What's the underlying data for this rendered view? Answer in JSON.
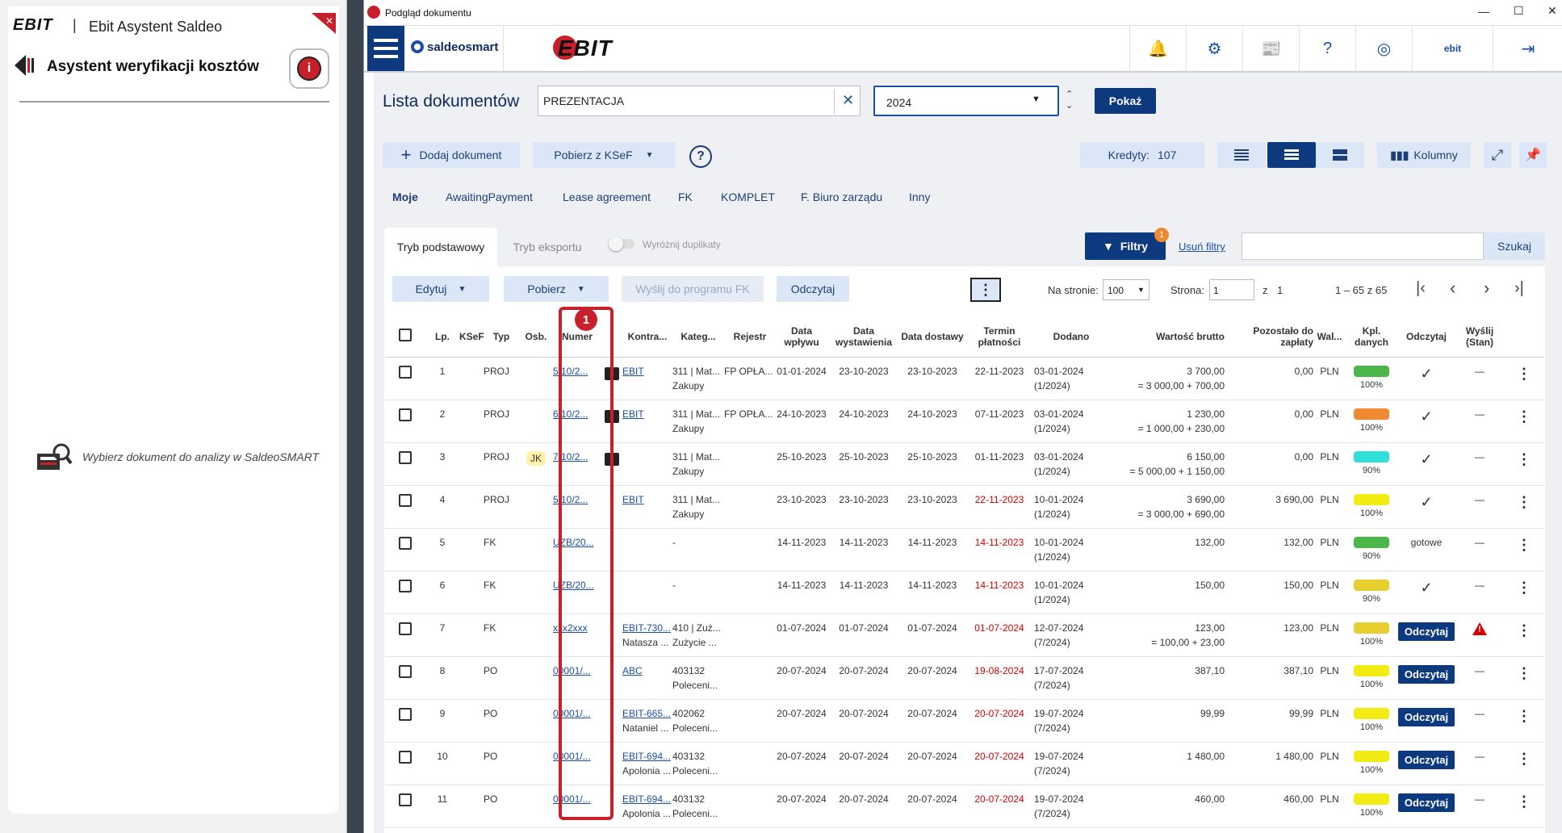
{
  "assistant": {
    "logo": "EBIT",
    "app_name": "Ebit Asystent Saldeo",
    "heading": "Asystent weryfikacji kosztów",
    "empty_message": "Wybierz dokument do analizy w SaldeoSMART"
  },
  "window": {
    "title": "Podgląd dokumentu",
    "controls": {
      "minimize": "—",
      "maximize": "☐",
      "close": "✕"
    }
  },
  "appbar": {
    "saldeo_logo": "saldeosmart",
    "ebit_logo": "EBIT",
    "user": "ebit"
  },
  "toolbar": {
    "page_title": "Lista dokumentów",
    "search_value": "PREZENTACJA",
    "year_value": "2024",
    "show_button": "Pokaż",
    "add_document": "Dodaj dokument",
    "fetch_ksef": "Pobierz z KSeF",
    "credits_label": "Kredyty:",
    "credits_value": "107",
    "columns_button": "Kolumny"
  },
  "categories": [
    "Moje",
    "AwaitingPayment",
    "Lease agreement",
    "FK",
    "KOMPLET",
    "F. Biuro zarządu",
    "Inny"
  ],
  "tabs": {
    "basic": "Tryb podstawowy",
    "export": "Tryb eksportu",
    "duplicates": "Wyróżnij duplikaty"
  },
  "filters": {
    "button": "Filtry",
    "badge": "1",
    "clear": "Usuń filtry",
    "search_button": "Szukaj",
    "search_value": ""
  },
  "actions": {
    "edit": "Edytuj",
    "download": "Pobierz",
    "send_fk": "Wyślij do programu FK",
    "read": "Odczytaj",
    "per_page_label": "Na stronie:",
    "per_page_value": "100",
    "page_label": "Strona:",
    "page_value": "1",
    "of_label": "z",
    "of_value": "1",
    "range": "1 – 65 z 65"
  },
  "annotation": {
    "marker": "1",
    "color": "#c8202a"
  },
  "colors": {
    "brand_dark": "#0d3a7e",
    "brand_light": "#dbe6f7",
    "green": "#4cb648",
    "orange": "#f08a32",
    "cyan": "#2ee0d8",
    "yellow": "#f2ec14",
    "gold": "#e8cf30",
    "red": "#d40000"
  },
  "table": {
    "headers": [
      "",
      "Lp.",
      "KSeF",
      "Typ",
      "Osb.",
      "Numer",
      "",
      "Kontra...",
      "Kateg...",
      "Rejestr",
      "Data wpływu",
      "Data wystawienia",
      "Data dostawy",
      "Termin płatności",
      "Dodano",
      "Wartość brutto",
      "Pozostało do zapłaty",
      "Wal...",
      "Kpl. danych",
      "Odczytaj",
      "Wyślij (Stan)",
      ""
    ],
    "rows": [
      {
        "lp": "1",
        "typ": "PROJ",
        "osb": "",
        "numer": "5/10/2...",
        "chat": true,
        "kontra": "EBIT",
        "kontra2": "",
        "kateg": "311 | Mat...",
        "kateg2": "Zakupy",
        "rejestr": "FP OPŁA...",
        "wplyw": "01-01-2024",
        "wyst": "23-10-2023",
        "dost": "23-10-2023",
        "termin": "22-11-2023",
        "termin_red": false,
        "dodano": "03-01-2024",
        "dodano2": "(1/2024)",
        "brutto": "3 700,00",
        "brutto2": "= 3 000,00 + 700,00",
        "pozostalo": "0,00",
        "wal": "PLN",
        "bar": "#4cb648",
        "pct": "100%",
        "odczytaj": "check",
        "wyslij": "—"
      },
      {
        "lp": "2",
        "typ": "PROJ",
        "osb": "",
        "numer": "6/10/2...",
        "chat": true,
        "kontra": "EBIT",
        "kontra2": "",
        "kateg": "311 | Mat...",
        "kateg2": "Zakupy",
        "rejestr": "FP OPŁA...",
        "wplyw": "24-10-2023",
        "wyst": "24-10-2023",
        "dost": "24-10-2023",
        "termin": "07-11-2023",
        "termin_red": false,
        "dodano": "03-01-2024",
        "dodano2": "(1/2024)",
        "brutto": "1 230,00",
        "brutto2": "= 1 000,00 + 230,00",
        "pozostalo": "0,00",
        "wal": "PLN",
        "bar": "#f08a32",
        "pct": "100%",
        "odczytaj": "check",
        "wyslij": "—"
      },
      {
        "lp": "3",
        "typ": "PROJ",
        "osb": "JK",
        "numer": "7/10/2...",
        "chat": true,
        "kontra": "",
        "kontra2": "",
        "kateg": "311 | Mat...",
        "kateg2": "Zakupy",
        "rejestr": "",
        "wplyw": "25-10-2023",
        "wyst": "25-10-2023",
        "dost": "25-10-2023",
        "termin": "01-11-2023",
        "termin_red": false,
        "dodano": "03-01-2024",
        "dodano2": "(1/2024)",
        "brutto": "6 150,00",
        "brutto2": "= 5 000,00 + 1 150,00",
        "pozostalo": "0,00",
        "wal": "PLN",
        "bar": "#2ee0d8",
        "pct": "90%",
        "odczytaj": "check",
        "wyslij": "—"
      },
      {
        "lp": "4",
        "typ": "PROJ",
        "osb": "",
        "numer": "5/10/2...",
        "chat": false,
        "kontra": "EBIT",
        "kontra2": "",
        "kateg": "311 | Mat...",
        "kateg2": "Zakupy",
        "rejestr": "",
        "wplyw": "23-10-2023",
        "wyst": "23-10-2023",
        "dost": "23-10-2023",
        "termin": "22-11-2023",
        "termin_red": true,
        "dodano": "10-01-2024",
        "dodano2": "(1/2024)",
        "brutto": "3 690,00",
        "brutto2": "= 3 000,00 + 690,00",
        "pozostalo": "3 690,00",
        "wal": "PLN",
        "bar": "#f2ec14",
        "pct": "100%",
        "odczytaj": "check",
        "wyslij": "—"
      },
      {
        "lp": "5",
        "typ": "FK",
        "osb": "",
        "numer": "UZB/20...",
        "chat": false,
        "kontra": "",
        "kontra2": "",
        "kateg": "-",
        "kateg2": "",
        "rejestr": "",
        "wplyw": "14-11-2023",
        "wyst": "14-11-2023",
        "dost": "14-11-2023",
        "termin": "14-11-2023",
        "termin_red": true,
        "dodano": "10-01-2024",
        "dodano2": "(1/2024)",
        "brutto": "132,00",
        "brutto2": "",
        "pozostalo": "132,00",
        "wal": "PLN",
        "bar": "#4cb648",
        "pct": "90%",
        "odczytaj": "gotowe",
        "wyslij": "—"
      },
      {
        "lp": "6",
        "typ": "FK",
        "osb": "",
        "numer": "UZB/20...",
        "chat": false,
        "kontra": "",
        "kontra2": "",
        "kateg": "-",
        "kateg2": "",
        "rejestr": "",
        "wplyw": "14-11-2023",
        "wyst": "14-11-2023",
        "dost": "14-11-2023",
        "termin": "14-11-2023",
        "termin_red": true,
        "dodano": "10-01-2024",
        "dodano2": "(1/2024)",
        "brutto": "150,00",
        "brutto2": "",
        "pozostalo": "150,00",
        "wal": "PLN",
        "bar": "#e8cf30",
        "pct": "90%",
        "odczytaj": "check",
        "wyslij": "—"
      },
      {
        "lp": "7",
        "typ": "FK",
        "osb": "",
        "numer": "xxx2xxx",
        "chat": false,
        "kontra": "EBIT-730...",
        "kontra2": "Natasza ...",
        "kateg": "410 | Zuż...",
        "kateg2": "Zużycie ...",
        "rejestr": "",
        "wplyw": "01-07-2024",
        "wyst": "01-07-2024",
        "dost": "01-07-2024",
        "termin": "01-07-2024",
        "termin_red": true,
        "dodano": "12-07-2024",
        "dodano2": "(7/2024)",
        "brutto": "123,00",
        "brutto2": "= 100,00 + 23,00",
        "pozostalo": "123,00",
        "wal": "PLN",
        "bar": "#e8cf30",
        "pct": "100%",
        "odczytaj": "button",
        "wyslij": "warning"
      },
      {
        "lp": "8",
        "typ": "PO",
        "osb": "",
        "numer": "00001/...",
        "chat": false,
        "kontra": "ABC",
        "kontra2": "",
        "kateg": "403132",
        "kateg2": "Poleceni...",
        "rejestr": "",
        "wplyw": "20-07-2024",
        "wyst": "20-07-2024",
        "dost": "20-07-2024",
        "termin": "19-08-2024",
        "termin_red": true,
        "dodano": "17-07-2024",
        "dodano2": "(7/2024)",
        "brutto": "387,10",
        "brutto2": "",
        "pozostalo": "387,10",
        "wal": "PLN",
        "bar": "#f2ec14",
        "pct": "100%",
        "odczytaj": "button",
        "wyslij": "—"
      },
      {
        "lp": "9",
        "typ": "PO",
        "osb": "",
        "numer": "00001/...",
        "chat": false,
        "kontra": "EBIT-665...",
        "kontra2": "Nataniel ...",
        "kateg": "402062",
        "kateg2": "Poleceni...",
        "rejestr": "",
        "wplyw": "20-07-2024",
        "wyst": "20-07-2024",
        "dost": "20-07-2024",
        "termin": "20-07-2024",
        "termin_red": true,
        "dodano": "19-07-2024",
        "dodano2": "(7/2024)",
        "brutto": "99,99",
        "brutto2": "",
        "pozostalo": "99,99",
        "wal": "PLN",
        "bar": "#f2ec14",
        "pct": "100%",
        "odczytaj": "button",
        "wyslij": "—"
      },
      {
        "lp": "10",
        "typ": "PO",
        "osb": "",
        "numer": "00001/...",
        "chat": false,
        "kontra": "EBIT-694...",
        "kontra2": "Apolonia ...",
        "kateg": "403132",
        "kateg2": "Poleceni...",
        "rejestr": "",
        "wplyw": "20-07-2024",
        "wyst": "20-07-2024",
        "dost": "20-07-2024",
        "termin": "20-07-2024",
        "termin_red": true,
        "dodano": "19-07-2024",
        "dodano2": "(7/2024)",
        "brutto": "1 480,00",
        "brutto2": "",
        "pozostalo": "1 480,00",
        "wal": "PLN",
        "bar": "#f2ec14",
        "pct": "100%",
        "odczytaj": "button",
        "wyslij": "—"
      },
      {
        "lp": "11",
        "typ": "PO",
        "osb": "",
        "numer": "00001/...",
        "chat": false,
        "kontra": "EBIT-694...",
        "kontra2": "Apolonia ...",
        "kateg": "403132",
        "kateg2": "Poleceni...",
        "rejestr": "",
        "wplyw": "20-07-2024",
        "wyst": "20-07-2024",
        "dost": "20-07-2024",
        "termin": "20-07-2024",
        "termin_red": true,
        "dodano": "19-07-2024",
        "dodano2": "(7/2024)",
        "brutto": "460,00",
        "brutto2": "",
        "pozostalo": "460,00",
        "wal": "PLN",
        "bar": "#f2ec14",
        "pct": "100%",
        "odczytaj": "button",
        "wyslij": "—"
      }
    ],
    "odczytaj_label": "Odczytaj",
    "check_glyph": "✓",
    "warning_glyph": "!",
    "kebab_glyph": "⋮"
  }
}
